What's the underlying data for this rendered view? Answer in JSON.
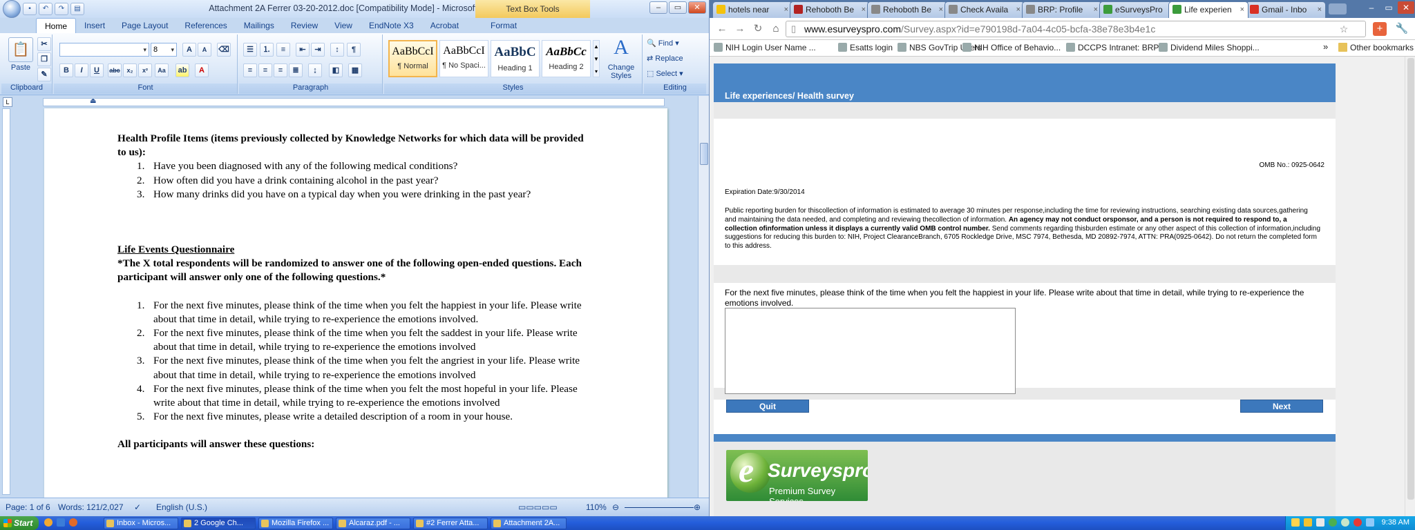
{
  "word": {
    "title": "Attachment 2A Ferrer 03-20-2012.doc [Compatibility Mode] - Microsoft Word",
    "context_tab": "Text Box Tools",
    "tabs": [
      "Home",
      "Insert",
      "Page Layout",
      "References",
      "Mailings",
      "Review",
      "View",
      "EndNote X3",
      "Acrobat",
      "Format"
    ],
    "ribbon": {
      "clipboard_label": "Clipboard",
      "paste_label": "Paste",
      "font_label": "Font",
      "font_size": "8",
      "paragraph_label": "Paragraph",
      "styles_label": "Styles",
      "editing_label": "Editing",
      "styles": [
        {
          "preview": "AaBbCcI",
          "name": "¶ Normal"
        },
        {
          "preview": "AaBbCcI",
          "name": "¶ No Spaci..."
        },
        {
          "preview": "AaBbC",
          "name": "Heading 1"
        },
        {
          "preview": "AaBbCc",
          "name": "Heading 2"
        }
      ],
      "change_styles_label": "Change Styles",
      "find_label": "Find",
      "replace_label": "Replace",
      "select_label": "Select"
    },
    "document": {
      "health_heading": "Health Profile Items (items previously collected by Knowledge Networks for which data will be provided to us):",
      "health_items": [
        "Have you been diagnosed with any of the following medical conditions?",
        "How often did you have a drink containing alcohol in the past year?",
        "How many drinks did you have on a typical day when you were drinking in the past year?"
      ],
      "life_events_heading": "Life Events Questionnaire",
      "life_events_note": "*The X total respondents will be randomized to answer one of the following open-ended questions. Each participant will answer only one of the following questions.*",
      "life_events_items": [
        "For the next five minutes, please think of the time when you felt the happiest in your life. Please write about that time in detail, while trying to re-experience the emotions involved.",
        "For the next five minutes, please think of the time when you felt the saddest in your life. Please write about that time in detail, while trying to re-experience the emotions involved",
        "For the next five minutes, please think of the time when you felt the angriest in your life. Please write about that time in detail, while trying to re-experience the emotions involved",
        "For the next five minutes, please think of the time when you felt the most hopeful in your life. Please write about that time in detail, while trying to re-experience the emotions involved",
        "For the next five minutes, please write a detailed description of a room in your house."
      ],
      "all_participants": "All participants will answer these questions:"
    },
    "status": {
      "page": "Page: 1 of 6",
      "words": "Words: 121/2,027",
      "language": "English (U.S.)",
      "zoom": "110%"
    }
  },
  "chrome": {
    "tabs": [
      {
        "label": "hotels near",
        "color": "#f4c20d"
      },
      {
        "label": "Rehoboth Be",
        "color": "#b22222"
      },
      {
        "label": "Rehoboth Be",
        "color": "#888888"
      },
      {
        "label": "Check Availa",
        "color": "#888888"
      },
      {
        "label": "BRP: Profile",
        "color": "#888888"
      },
      {
        "label": "eSurveysPro",
        "color": "#3c9c3c"
      },
      {
        "label": "Life experien",
        "color": "#3c9c3c"
      },
      {
        "label": "Gmail - Inbo",
        "color": "#d93025"
      }
    ],
    "url_host": "www.esurveyspro.com",
    "url_path": "/Survey.aspx?id=e790198d-7a04-4c05-bcfa-38e78e3b4e1c",
    "bookmarks": [
      "NIH Login User Name ...",
      "Esatts login",
      "NBS GovTrip Users",
      "NIH Office of Behavio...",
      "DCCPS Intranet: BRP",
      "Dividend Miles Shoppi..."
    ],
    "other_bookmarks": "Other bookmarks",
    "survey": {
      "title": "Life experiences/ Health survey",
      "omb": "OMB No.: 0925-0642",
      "expiration": "Expiration  Date:9/30/2014",
      "burden_text_1": "Public reporting burden for thiscollection of information is estimated to average 30 minutes per response,including the time for reviewing instructions, searching existing data sources,gathering and maintaining the data needed, and completing and reviewing thecollection of information. ",
      "burden_text_bold": "An agency may not conduct orsponsor, and a person is not required to respond to, a collection ofinformation unless it displays a currently valid OMB control number.",
      "burden_text_2": " Send comments regarding thisburden estimate or any other aspect of this collection of information,including suggestions for reducing this burden to: NIH, Project ClearanceBranch, 6705 Rockledge Drive, MSC 7974, Bethesda, MD 20892-7974, ATTN: PRA(0925-0642). Do not return the completed form to this address.",
      "question": "For the next five minutes, please think of the time when you felt the happiest in your life. Please write about that time in detail, while trying to re-experience the emotions involved.",
      "answer": "",
      "quit_label": "Quit",
      "next_label": "Next",
      "logo_brand": "Surveyspro",
      "logo_tagline": "Premium Survey Services"
    }
  },
  "taskbar": {
    "start_label": "Start",
    "items": [
      {
        "label": "Inbox - Micros...",
        "active": false
      },
      {
        "label": "2 Google Ch...",
        "active": true
      },
      {
        "label": "Mozilla Firefox ...",
        "active": false
      },
      {
        "label": "Alcaraz.pdf - ...",
        "active": false
      },
      {
        "label": "#2 Ferrer Atta...",
        "active": false
      },
      {
        "label": "Attachment 2A...",
        "active": false
      }
    ],
    "time": "9:38 AM"
  }
}
